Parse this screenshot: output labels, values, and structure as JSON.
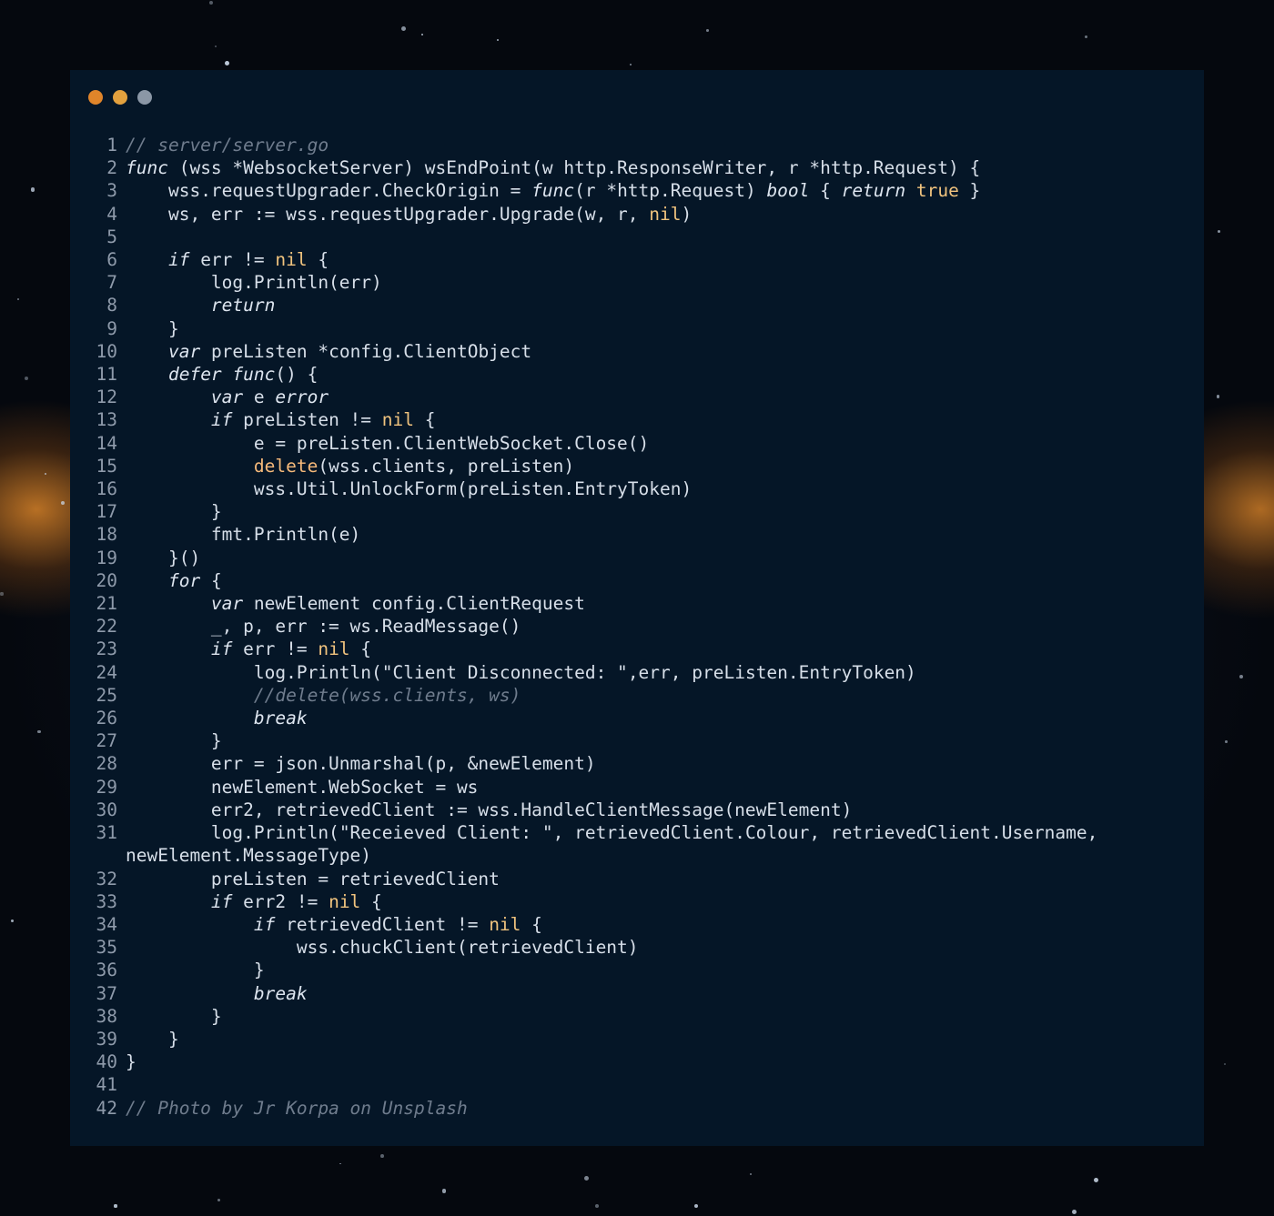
{
  "window": {
    "controls": [
      {
        "name": "close",
        "color": "#e0852a"
      },
      {
        "name": "minimize",
        "color": "#e3a13e"
      },
      {
        "name": "maximize",
        "color": "#8b97a6"
      }
    ]
  },
  "code": {
    "language": "go",
    "lines": [
      {
        "n": "1",
        "segs": [
          {
            "t": "// server/server.go",
            "k": "cm"
          }
        ]
      },
      {
        "n": "2",
        "segs": [
          {
            "t": "func",
            "k": "kw"
          },
          {
            "t": " (wss *WebsocketServer) wsEndPoint(w http.ResponseWriter, r *http.Request) {"
          }
        ]
      },
      {
        "n": "3",
        "segs": [
          {
            "t": "    wss.requestUpgrader.CheckOrigin = "
          },
          {
            "t": "func",
            "k": "kw"
          },
          {
            "t": "(r *http.Request) "
          },
          {
            "t": "bool",
            "k": "kw"
          },
          {
            "t": " { "
          },
          {
            "t": "return",
            "k": "kw"
          },
          {
            "t": " "
          },
          {
            "t": "true",
            "k": "lit"
          },
          {
            "t": " }"
          }
        ]
      },
      {
        "n": "4",
        "segs": [
          {
            "t": "    ws, err := wss.requestUpgrader.Upgrade(w, r, "
          },
          {
            "t": "nil",
            "k": "lit"
          },
          {
            "t": ")"
          }
        ]
      },
      {
        "n": "5",
        "segs": [
          {
            "t": ""
          }
        ]
      },
      {
        "n": "6",
        "segs": [
          {
            "t": "    "
          },
          {
            "t": "if",
            "k": "kw"
          },
          {
            "t": " err != "
          },
          {
            "t": "nil",
            "k": "lit"
          },
          {
            "t": " {"
          }
        ]
      },
      {
        "n": "7",
        "segs": [
          {
            "t": "        log.Println(err)"
          }
        ]
      },
      {
        "n": "8",
        "segs": [
          {
            "t": "        "
          },
          {
            "t": "return",
            "k": "kw"
          }
        ]
      },
      {
        "n": "9",
        "segs": [
          {
            "t": "    }"
          }
        ]
      },
      {
        "n": "10",
        "segs": [
          {
            "t": "    "
          },
          {
            "t": "var",
            "k": "kw"
          },
          {
            "t": " preListen *config.ClientObject"
          }
        ]
      },
      {
        "n": "11",
        "segs": [
          {
            "t": "    "
          },
          {
            "t": "defer",
            "k": "kw"
          },
          {
            "t": " "
          },
          {
            "t": "func",
            "k": "kw"
          },
          {
            "t": "() {"
          }
        ]
      },
      {
        "n": "12",
        "segs": [
          {
            "t": "        "
          },
          {
            "t": "var",
            "k": "kw"
          },
          {
            "t": " e "
          },
          {
            "t": "error",
            "k": "kw"
          }
        ]
      },
      {
        "n": "13",
        "segs": [
          {
            "t": "        "
          },
          {
            "t": "if",
            "k": "kw"
          },
          {
            "t": " preListen != "
          },
          {
            "t": "nil",
            "k": "lit"
          },
          {
            "t": " {"
          }
        ]
      },
      {
        "n": "14",
        "segs": [
          {
            "t": "            e = preListen.ClientWebSocket.Close()"
          }
        ]
      },
      {
        "n": "15",
        "segs": [
          {
            "t": "            "
          },
          {
            "t": "delete",
            "k": "bi"
          },
          {
            "t": "(wss.clients, preListen)"
          }
        ]
      },
      {
        "n": "16",
        "segs": [
          {
            "t": "            wss.Util.UnlockForm(preListen.EntryToken)"
          }
        ]
      },
      {
        "n": "17",
        "segs": [
          {
            "t": "        }"
          }
        ]
      },
      {
        "n": "18",
        "segs": [
          {
            "t": "        fmt.Println(e)"
          }
        ]
      },
      {
        "n": "19",
        "segs": [
          {
            "t": "    }()"
          }
        ]
      },
      {
        "n": "20",
        "segs": [
          {
            "t": "    "
          },
          {
            "t": "for",
            "k": "kw"
          },
          {
            "t": " {"
          }
        ]
      },
      {
        "n": "21",
        "segs": [
          {
            "t": "        "
          },
          {
            "t": "var",
            "k": "kw"
          },
          {
            "t": " newElement config.ClientRequest"
          }
        ]
      },
      {
        "n": "22",
        "segs": [
          {
            "t": "        _, p, err := ws.ReadMessage()"
          }
        ]
      },
      {
        "n": "23",
        "segs": [
          {
            "t": "        "
          },
          {
            "t": "if",
            "k": "kw"
          },
          {
            "t": " err != "
          },
          {
            "t": "nil",
            "k": "lit"
          },
          {
            "t": " {"
          }
        ]
      },
      {
        "n": "24",
        "segs": [
          {
            "t": "            log.Println("
          },
          {
            "t": "\"Client Disconnected: \"",
            "k": "st"
          },
          {
            "t": ",err, preListen.EntryToken)"
          }
        ]
      },
      {
        "n": "25",
        "segs": [
          {
            "t": "            "
          },
          {
            "t": "//delete(wss.clients, ws)",
            "k": "cm"
          }
        ]
      },
      {
        "n": "26",
        "segs": [
          {
            "t": "            "
          },
          {
            "t": "break",
            "k": "kw"
          }
        ]
      },
      {
        "n": "27",
        "segs": [
          {
            "t": "        }"
          }
        ]
      },
      {
        "n": "28",
        "segs": [
          {
            "t": "        err = json.Unmarshal(p, &newElement)"
          }
        ]
      },
      {
        "n": "29",
        "segs": [
          {
            "t": "        newElement.WebSocket = ws"
          }
        ]
      },
      {
        "n": "30",
        "segs": [
          {
            "t": "        err2, retrievedClient := wss.HandleClientMessage(newElement)"
          }
        ]
      },
      {
        "n": "31",
        "segs": [
          {
            "t": "        log.Println("
          },
          {
            "t": "\"Receieved Client: \"",
            "k": "st"
          },
          {
            "t": ", retrievedClient.Colour, retrievedClient.Username,"
          }
        ]
      },
      {
        "n": "",
        "segs": [
          {
            "t": "newElement.MessageType)"
          }
        ]
      },
      {
        "n": "32",
        "segs": [
          {
            "t": "        preListen = retrievedClient"
          }
        ]
      },
      {
        "n": "33",
        "segs": [
          {
            "t": "        "
          },
          {
            "t": "if",
            "k": "kw"
          },
          {
            "t": " err2 != "
          },
          {
            "t": "nil",
            "k": "lit"
          },
          {
            "t": " {"
          }
        ]
      },
      {
        "n": "34",
        "segs": [
          {
            "t": "            "
          },
          {
            "t": "if",
            "k": "kw"
          },
          {
            "t": " retrievedClient != "
          },
          {
            "t": "nil",
            "k": "lit"
          },
          {
            "t": " {"
          }
        ]
      },
      {
        "n": "35",
        "segs": [
          {
            "t": "                wss.chuckClient(retrievedClient)"
          }
        ]
      },
      {
        "n": "36",
        "segs": [
          {
            "t": "            }"
          }
        ]
      },
      {
        "n": "37",
        "segs": [
          {
            "t": "            "
          },
          {
            "t": "break",
            "k": "kw"
          }
        ]
      },
      {
        "n": "38",
        "segs": [
          {
            "t": "        }"
          }
        ]
      },
      {
        "n": "39",
        "segs": [
          {
            "t": "    }"
          }
        ]
      },
      {
        "n": "40",
        "segs": [
          {
            "t": "}"
          }
        ]
      },
      {
        "n": "41",
        "segs": [
          {
            "t": ""
          }
        ]
      },
      {
        "n": "42",
        "segs": [
          {
            "t": "// Photo by Jr Korpa on Unsplash",
            "k": "cm"
          }
        ]
      }
    ]
  }
}
